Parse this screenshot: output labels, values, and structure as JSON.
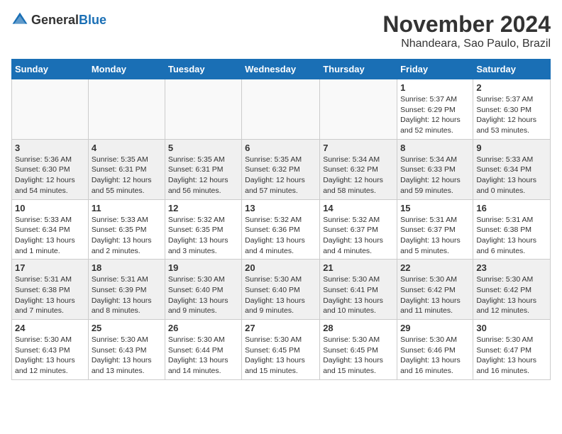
{
  "header": {
    "logo_general": "General",
    "logo_blue": "Blue",
    "month_year": "November 2024",
    "location": "Nhandeara, Sao Paulo, Brazil"
  },
  "days_of_week": [
    "Sunday",
    "Monday",
    "Tuesday",
    "Wednesday",
    "Thursday",
    "Friday",
    "Saturday"
  ],
  "weeks": [
    {
      "shaded": false,
      "days": [
        {
          "date": "",
          "info": ""
        },
        {
          "date": "",
          "info": ""
        },
        {
          "date": "",
          "info": ""
        },
        {
          "date": "",
          "info": ""
        },
        {
          "date": "",
          "info": ""
        },
        {
          "date": "1",
          "info": "Sunrise: 5:37 AM\nSunset: 6:29 PM\nDaylight: 12 hours\nand 52 minutes."
        },
        {
          "date": "2",
          "info": "Sunrise: 5:37 AM\nSunset: 6:30 PM\nDaylight: 12 hours\nand 53 minutes."
        }
      ]
    },
    {
      "shaded": true,
      "days": [
        {
          "date": "3",
          "info": "Sunrise: 5:36 AM\nSunset: 6:30 PM\nDaylight: 12 hours\nand 54 minutes."
        },
        {
          "date": "4",
          "info": "Sunrise: 5:35 AM\nSunset: 6:31 PM\nDaylight: 12 hours\nand 55 minutes."
        },
        {
          "date": "5",
          "info": "Sunrise: 5:35 AM\nSunset: 6:31 PM\nDaylight: 12 hours\nand 56 minutes."
        },
        {
          "date": "6",
          "info": "Sunrise: 5:35 AM\nSunset: 6:32 PM\nDaylight: 12 hours\nand 57 minutes."
        },
        {
          "date": "7",
          "info": "Sunrise: 5:34 AM\nSunset: 6:32 PM\nDaylight: 12 hours\nand 58 minutes."
        },
        {
          "date": "8",
          "info": "Sunrise: 5:34 AM\nSunset: 6:33 PM\nDaylight: 12 hours\nand 59 minutes."
        },
        {
          "date": "9",
          "info": "Sunrise: 5:33 AM\nSunset: 6:34 PM\nDaylight: 13 hours\nand 0 minutes."
        }
      ]
    },
    {
      "shaded": false,
      "days": [
        {
          "date": "10",
          "info": "Sunrise: 5:33 AM\nSunset: 6:34 PM\nDaylight: 13 hours\nand 1 minute."
        },
        {
          "date": "11",
          "info": "Sunrise: 5:33 AM\nSunset: 6:35 PM\nDaylight: 13 hours\nand 2 minutes."
        },
        {
          "date": "12",
          "info": "Sunrise: 5:32 AM\nSunset: 6:35 PM\nDaylight: 13 hours\nand 3 minutes."
        },
        {
          "date": "13",
          "info": "Sunrise: 5:32 AM\nSunset: 6:36 PM\nDaylight: 13 hours\nand 4 minutes."
        },
        {
          "date": "14",
          "info": "Sunrise: 5:32 AM\nSunset: 6:37 PM\nDaylight: 13 hours\nand 4 minutes."
        },
        {
          "date": "15",
          "info": "Sunrise: 5:31 AM\nSunset: 6:37 PM\nDaylight: 13 hours\nand 5 minutes."
        },
        {
          "date": "16",
          "info": "Sunrise: 5:31 AM\nSunset: 6:38 PM\nDaylight: 13 hours\nand 6 minutes."
        }
      ]
    },
    {
      "shaded": true,
      "days": [
        {
          "date": "17",
          "info": "Sunrise: 5:31 AM\nSunset: 6:38 PM\nDaylight: 13 hours\nand 7 minutes."
        },
        {
          "date": "18",
          "info": "Sunrise: 5:31 AM\nSunset: 6:39 PM\nDaylight: 13 hours\nand 8 minutes."
        },
        {
          "date": "19",
          "info": "Sunrise: 5:30 AM\nSunset: 6:40 PM\nDaylight: 13 hours\nand 9 minutes."
        },
        {
          "date": "20",
          "info": "Sunrise: 5:30 AM\nSunset: 6:40 PM\nDaylight: 13 hours\nand 9 minutes."
        },
        {
          "date": "21",
          "info": "Sunrise: 5:30 AM\nSunset: 6:41 PM\nDaylight: 13 hours\nand 10 minutes."
        },
        {
          "date": "22",
          "info": "Sunrise: 5:30 AM\nSunset: 6:42 PM\nDaylight: 13 hours\nand 11 minutes."
        },
        {
          "date": "23",
          "info": "Sunrise: 5:30 AM\nSunset: 6:42 PM\nDaylight: 13 hours\nand 12 minutes."
        }
      ]
    },
    {
      "shaded": false,
      "days": [
        {
          "date": "24",
          "info": "Sunrise: 5:30 AM\nSunset: 6:43 PM\nDaylight: 13 hours\nand 12 minutes."
        },
        {
          "date": "25",
          "info": "Sunrise: 5:30 AM\nSunset: 6:43 PM\nDaylight: 13 hours\nand 13 minutes."
        },
        {
          "date": "26",
          "info": "Sunrise: 5:30 AM\nSunset: 6:44 PM\nDaylight: 13 hours\nand 14 minutes."
        },
        {
          "date": "27",
          "info": "Sunrise: 5:30 AM\nSunset: 6:45 PM\nDaylight: 13 hours\nand 15 minutes."
        },
        {
          "date": "28",
          "info": "Sunrise: 5:30 AM\nSunset: 6:45 PM\nDaylight: 13 hours\nand 15 minutes."
        },
        {
          "date": "29",
          "info": "Sunrise: 5:30 AM\nSunset: 6:46 PM\nDaylight: 13 hours\nand 16 minutes."
        },
        {
          "date": "30",
          "info": "Sunrise: 5:30 AM\nSunset: 6:47 PM\nDaylight: 13 hours\nand 16 minutes."
        }
      ]
    }
  ]
}
